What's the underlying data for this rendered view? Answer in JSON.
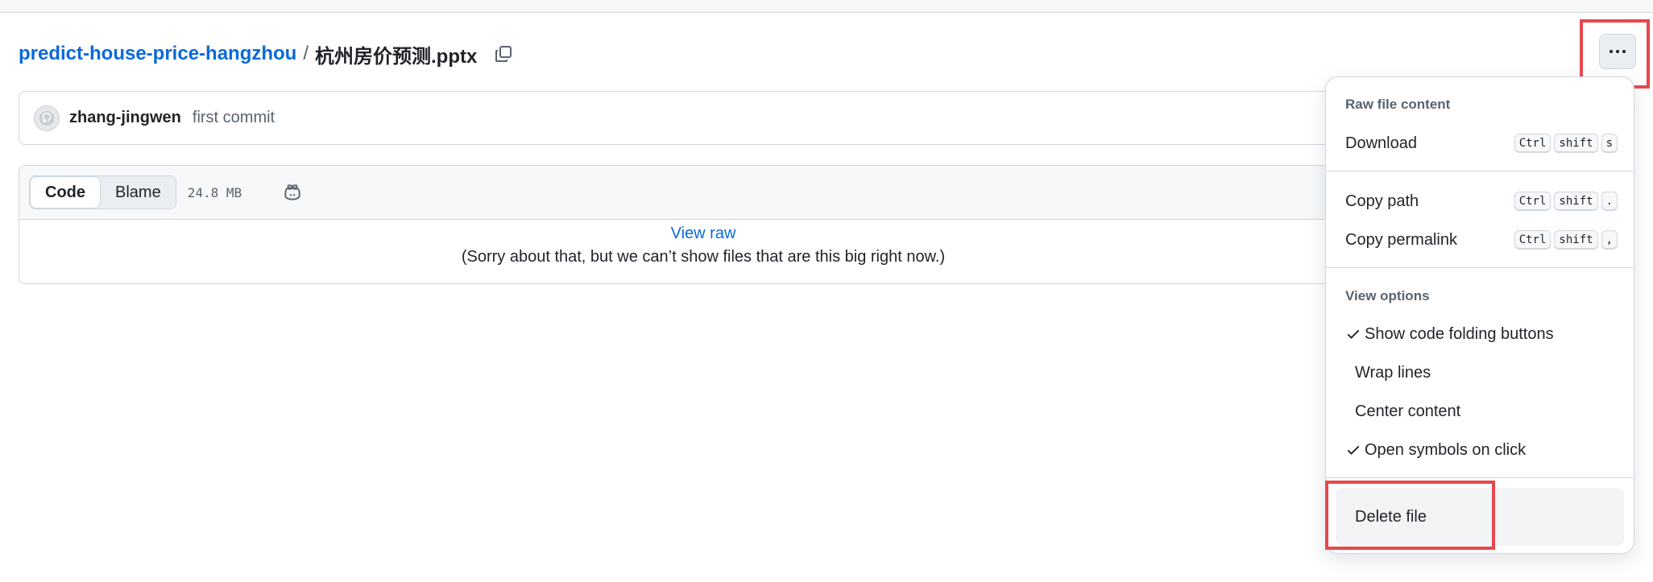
{
  "breadcrumb": {
    "repo": "predict-house-price-hangzhou",
    "separator": "/",
    "file": "杭州房价预测.pptx"
  },
  "commit": {
    "author": "zhang-jingwen",
    "message": "first commit"
  },
  "file_view": {
    "tabs": [
      "Code",
      "Blame"
    ],
    "active_tab": "Code",
    "size": "24.8 MB",
    "view_raw": "View raw",
    "notice": "(Sorry about that, but we can’t show files that are this big right now.)"
  },
  "menu": {
    "section_raw": "Raw file content",
    "download": {
      "label": "Download",
      "keys": [
        "Ctrl",
        "shift",
        "s"
      ]
    },
    "copy_path": {
      "label": "Copy path",
      "keys": [
        "Ctrl",
        "shift",
        "."
      ]
    },
    "copy_permalink": {
      "label": "Copy permalink",
      "keys": [
        "Ctrl",
        "shift",
        ","
      ]
    },
    "section_view": "View options",
    "options": [
      {
        "label": "Show code folding buttons",
        "checked": true
      },
      {
        "label": "Wrap lines",
        "checked": false
      },
      {
        "label": "Center content",
        "checked": false
      },
      {
        "label": "Open symbols on click",
        "checked": true
      }
    ],
    "delete": "Delete file"
  },
  "colors": {
    "link": "#0969da",
    "highlight": "#e5484d",
    "border": "#d0d7de"
  },
  "icons": [
    "copy-icon",
    "kebab-icon",
    "avatar-icon",
    "copilot-icon",
    "check-icon"
  ]
}
